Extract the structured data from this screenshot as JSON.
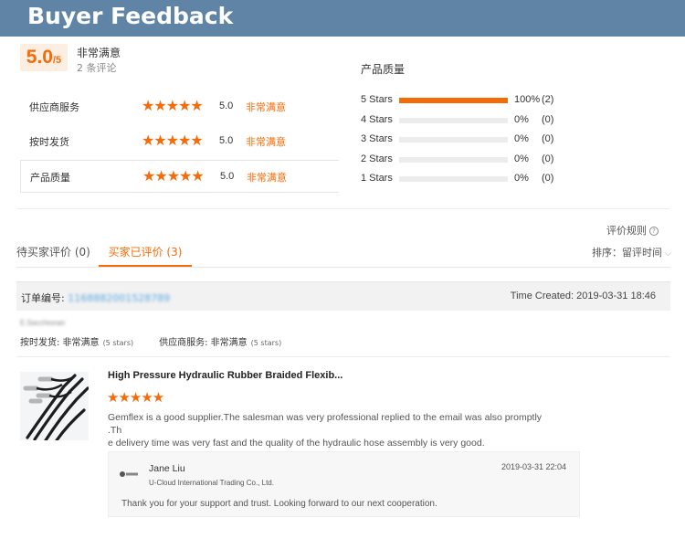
{
  "banner": {
    "title": "Buyer Feedback"
  },
  "summary": {
    "score": "5.0",
    "score_max": "/5",
    "label": "非常满意",
    "review_count": "2 条评论",
    "ratings": [
      {
        "label": "供应商服务",
        "stars": "★★★★★",
        "score": "5.0",
        "text": "非常满意"
      },
      {
        "label": "按时发货",
        "stars": "★★★★★",
        "score": "5.0",
        "text": "非常满意"
      },
      {
        "label": "产品质量",
        "stars": "★★★★★",
        "score": "5.0",
        "text": "非常满意"
      }
    ]
  },
  "distribution": {
    "title": "产品质量",
    "rows": [
      {
        "label": "5 Stars",
        "fraction": 1.0,
        "percent": "100%",
        "count": "(2)"
      },
      {
        "label": "4 Stars",
        "fraction": 0,
        "percent": "0%",
        "count": "(0)"
      },
      {
        "label": "3 Stars",
        "fraction": 0,
        "percent": "0%",
        "count": "(0)"
      },
      {
        "label": "2 Stars",
        "fraction": 0,
        "percent": "0%",
        "count": "(0)"
      },
      {
        "label": "1 Stars",
        "fraction": 0,
        "percent": "0%",
        "count": "(0)"
      }
    ],
    "accent_color": "#f56b08"
  },
  "tabs": {
    "rules_label": "评价规则",
    "rules_icon": "?",
    "pending": "待买家评价 (0)",
    "reviewed": "买家已评价 (3)",
    "sort_label": "排序：留评时间",
    "sort_chevron": "⌵"
  },
  "order": {
    "label": "订单编号: ",
    "number": "1168882001528789",
    "time_created": "Time Created: 2019-03-31 18:46"
  },
  "review": {
    "buyer_name": "E.Sacchionan",
    "buyer_ratings": {
      "shipping_label": "按时发货: 非常满意",
      "shipping_stars": "(5 stars)",
      "service_label": "供应商服务: 非常满意",
      "service_stars": "(5 stars)"
    },
    "product_title": "High Pressure Hydraulic Rubber Braided Flexib...",
    "stars": "★★★★★",
    "text_line1": "Gemflex is a good supplier.The salesman was very professional  replied to the email was also promptly .Th",
    "text_line2": "e delivery time was very fast and the quality of the hydraulic hose assembly is very good."
  },
  "reply": {
    "name": "Jane Liu",
    "company": "U-Cloud International Trading Co., Ltd.",
    "time": "2019-03-31 22:04",
    "message": "Thank you for your support and trust. Looking forward to our next cooperation."
  }
}
